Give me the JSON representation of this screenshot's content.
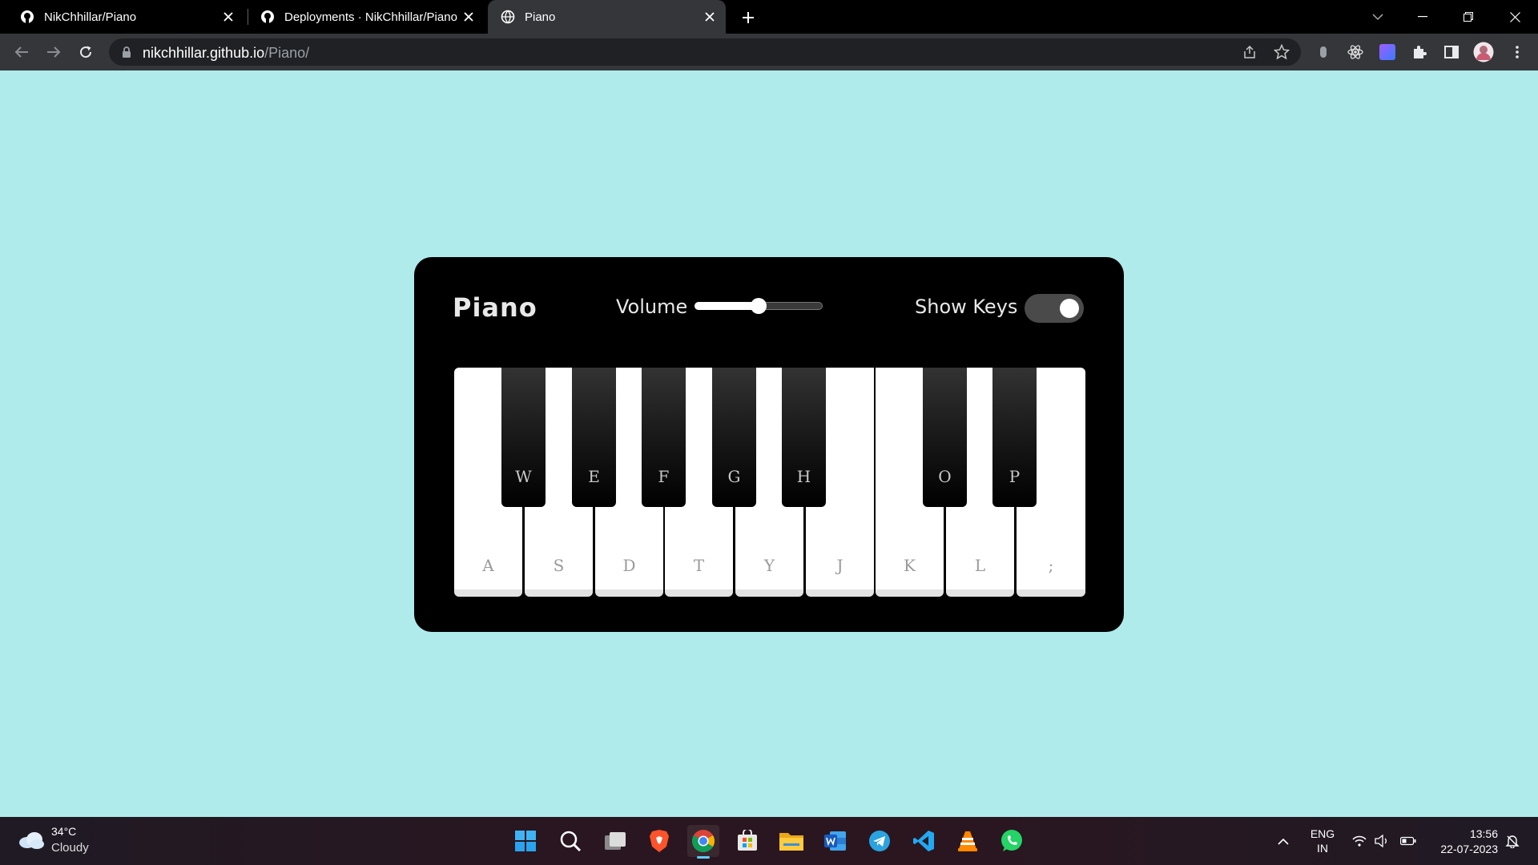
{
  "browser": {
    "tabs": [
      {
        "title": "NikChhillar/Piano",
        "icon": "github-icon",
        "active": false
      },
      {
        "title": "Deployments · NikChhillar/Piano",
        "icon": "github-icon",
        "active": false
      },
      {
        "title": "Piano",
        "icon": "globe-icon",
        "active": true
      }
    ],
    "url_host": "nikchhillar.github.io",
    "url_path": "/Piano/"
  },
  "piano": {
    "title": "Piano",
    "volume_label": "Volume",
    "volume_level": 0.5,
    "show_keys_label": "Show Keys",
    "show_keys_on": true,
    "white_keys": [
      "A",
      "S",
      "D",
      "T",
      "Y",
      "J",
      "K",
      "L",
      ";"
    ],
    "black_keys": [
      "W",
      "E",
      "F",
      "G",
      "H",
      "O",
      "P"
    ]
  },
  "taskbar": {
    "weather_temp": "34°C",
    "weather_condition": "Cloudy",
    "apps": [
      "start-icon",
      "search-icon",
      "task-view-icon",
      "brave-icon",
      "chrome-icon",
      "store-icon",
      "file-explorer-icon",
      "word-icon",
      "telegram-icon",
      "vscode-icon",
      "vlc-icon",
      "whatsapp-icon"
    ],
    "lang_line1": "ENG",
    "lang_line2": "IN",
    "time": "13:56",
    "date": "22-07-2023"
  },
  "colors": {
    "page_background": "#afebeb",
    "piano_body": "#000000",
    "accent": "#60cdff"
  }
}
